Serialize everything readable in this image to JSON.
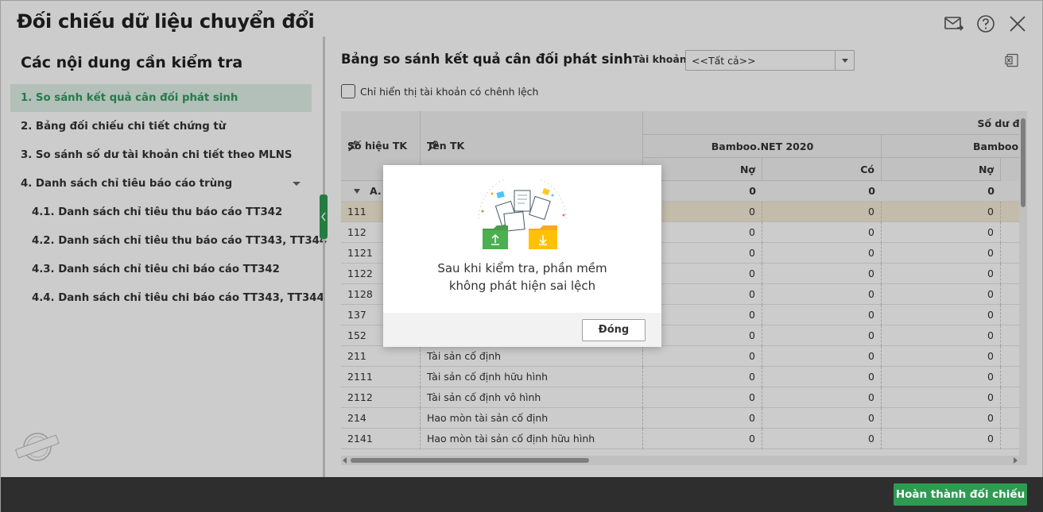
{
  "window": {
    "title": "Đối chiếu dữ liệu chuyển đổi"
  },
  "left": {
    "heading": "Các nội dung cần kiểm tra",
    "items": [
      {
        "label": "1. So sánh kết quả cân đối phát sinh",
        "active": true
      },
      {
        "label": "2. Bảng đối chiếu chi tiết chứng từ"
      },
      {
        "label": "3. So sánh số dư tài khoản chi tiết theo MLNS"
      },
      {
        "label": "4. Danh sách chỉ tiêu báo cáo trùng"
      },
      {
        "label": "4.1. Danh sách chỉ tiêu thu báo cáo TT342"
      },
      {
        "label": "4.2. Danh sách chỉ tiêu thu báo cáo TT343, TT344"
      },
      {
        "label": "4.3. Danh sách chỉ tiêu chi báo cáo TT342"
      },
      {
        "label": "4.4. Danh sách chỉ tiêu chi báo cáo TT343, TT344"
      }
    ],
    "stamp_text": "DỮ LIỆU MẪU"
  },
  "right": {
    "heading": "Bảng so sánh kết quả cân đối phát sinh",
    "account_label": "Tài khoản",
    "account_value": "<<Tất cả>>",
    "checkbox_label": "Chỉ hiển thị tài khoản có chênh lệch"
  },
  "grid": {
    "col_account": "Số hiệu TK",
    "col_name": "Tên TK",
    "group_header": "Số dư đầ",
    "sub_header_1": "Bamboo.NET 2020",
    "sub_header_2": "Bamboo C",
    "debit": "Nợ",
    "credit": "Có",
    "group_row": {
      "label": "A.",
      "v1": "0",
      "v2": "0",
      "v3": "0"
    },
    "rows": [
      {
        "acct": "111",
        "name": "",
        "v1": "0",
        "v2": "0",
        "v3": "0"
      },
      {
        "acct": "112",
        "name": "",
        "v1": "0",
        "v2": "0",
        "v3": "0"
      },
      {
        "acct": "1121",
        "name": "",
        "v1": "0",
        "v2": "0",
        "v3": "0"
      },
      {
        "acct": "1122",
        "name": "",
        "v1": "0",
        "v2": "0",
        "v3": "0"
      },
      {
        "acct": "1128",
        "name": "",
        "v1": "0",
        "v2": "0",
        "v3": "0"
      },
      {
        "acct": "137",
        "name": "",
        "v1": "0",
        "v2": "0",
        "v3": "0"
      },
      {
        "acct": "152",
        "name": "",
        "v1": "0",
        "v2": "0",
        "v3": "0"
      },
      {
        "acct": "211",
        "name": "Tài sản cố định",
        "v1": "0",
        "v2": "0",
        "v3": "0"
      },
      {
        "acct": "2111",
        "name": "Tài sản cố định hữu hình",
        "v1": "0",
        "v2": "0",
        "v3": "0"
      },
      {
        "acct": "2112",
        "name": "Tài sản cố định vô hình",
        "v1": "0",
        "v2": "0",
        "v3": "0"
      },
      {
        "acct": "214",
        "name": "Hao mòn tài sản cố định",
        "v1": "0",
        "v2": "0",
        "v3": "0"
      },
      {
        "acct": "2141",
        "name": "Hao mòn tài sản cố định hữu hình",
        "v1": "0",
        "v2": "0",
        "v3": "0"
      }
    ]
  },
  "dialog": {
    "message_line1": "Sau khi kiểm tra, phần mềm",
    "message_line2": "không phát hiện sai lệch",
    "close_label": "Đóng"
  },
  "footer": {
    "finish_label": "Hoàn thành đối chiếu"
  },
  "colors": {
    "accent": "#2f9a52",
    "active_bg": "#e0efe8",
    "footer": "#2e2e2e",
    "selected_row": "#f4ecd6"
  }
}
